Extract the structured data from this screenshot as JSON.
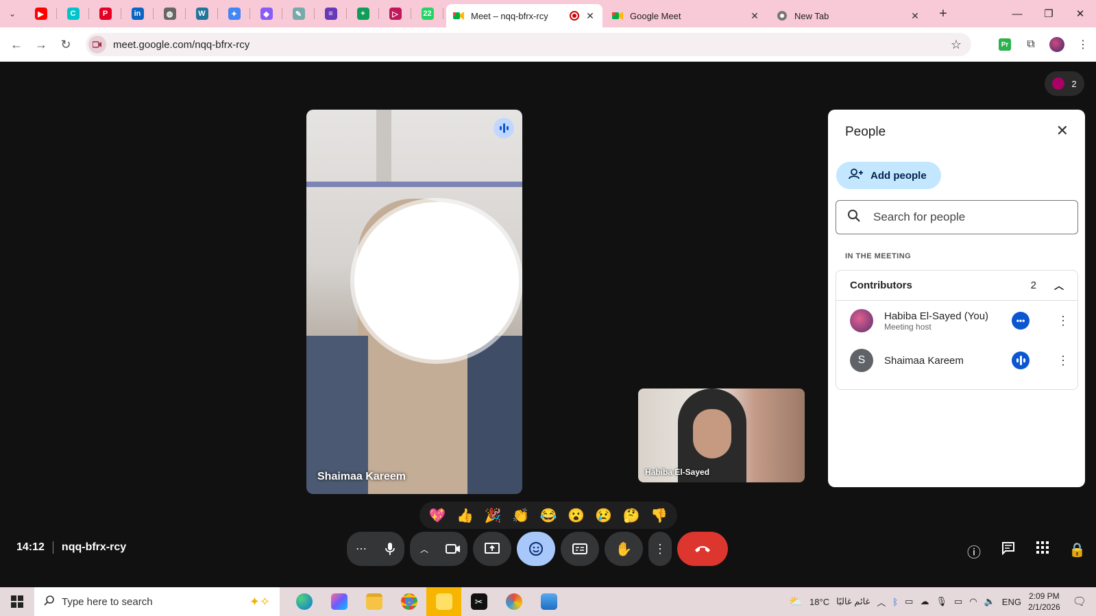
{
  "browser": {
    "pinned": [
      {
        "icon": "youtube-icon",
        "color": "#ff0000",
        "glyph": "▶"
      },
      {
        "icon": "canva-icon",
        "color": "#00c4cc",
        "glyph": "C"
      },
      {
        "icon": "pinterest-icon",
        "color": "#e60023",
        "glyph": "P"
      },
      {
        "icon": "linkedin-icon",
        "color": "#0a66c2",
        "glyph": "in"
      },
      {
        "icon": "globe-icon",
        "color": "#666",
        "glyph": "◍"
      },
      {
        "icon": "wordpress-icon",
        "color": "#21759b",
        "glyph": "W"
      },
      {
        "icon": "gemini-icon",
        "color": "#4285f4",
        "glyph": "✦"
      },
      {
        "icon": "copilot-icon",
        "color": "#8a5cf6",
        "glyph": "◆"
      },
      {
        "icon": "pencil-icon",
        "color": "#7aa",
        "glyph": "✎"
      },
      {
        "icon": "forms-icon",
        "color": "#673ab7",
        "glyph": "≡"
      },
      {
        "icon": "sheets-icon",
        "color": "#0f9d58",
        "glyph": "+"
      },
      {
        "icon": "slides-icon",
        "color": "#c2185b",
        "glyph": "▷"
      },
      {
        "icon": "whatsapp-icon",
        "color": "#25d366",
        "glyph": "22"
      }
    ],
    "tabs": [
      {
        "title": "Meet – nqq-bfrx-rcy",
        "active": true
      },
      {
        "title": "Google Meet",
        "active": false
      },
      {
        "title": "New Tab",
        "active": false
      }
    ],
    "url": "meet.google.com/nqq-bfrx-rcy"
  },
  "meeting": {
    "main_tile_name": "Shaimaa Kareem",
    "self_tile_name": "Habiba El-Sayed",
    "participant_count": "2",
    "time": "14:12",
    "code": "nqq-bfrx-rcy",
    "reactions": [
      "💖",
      "👍",
      "🎉",
      "👏",
      "😂",
      "😮",
      "😢",
      "🤔",
      "👎"
    ]
  },
  "people_panel": {
    "title": "People",
    "add_label": "Add people",
    "search_placeholder": "Search for people",
    "section_label": "IN THE MEETING",
    "group_label": "Contributors",
    "group_count": "2",
    "people": [
      {
        "name": "Habiba El-Sayed (You)",
        "role": "Meeting host",
        "avatar_color": "#b03070"
      },
      {
        "name": "Shaimaa Kareem",
        "role": "",
        "avatar_initial": "S",
        "avatar_color": "#5f6368"
      }
    ]
  },
  "taskbar": {
    "search_placeholder": "Type here to search",
    "weather": "18°C",
    "weather_text": "غائم غالبًا",
    "lang": "ENG",
    "time": "2:09 PM",
    "date": "2/1/2026"
  }
}
